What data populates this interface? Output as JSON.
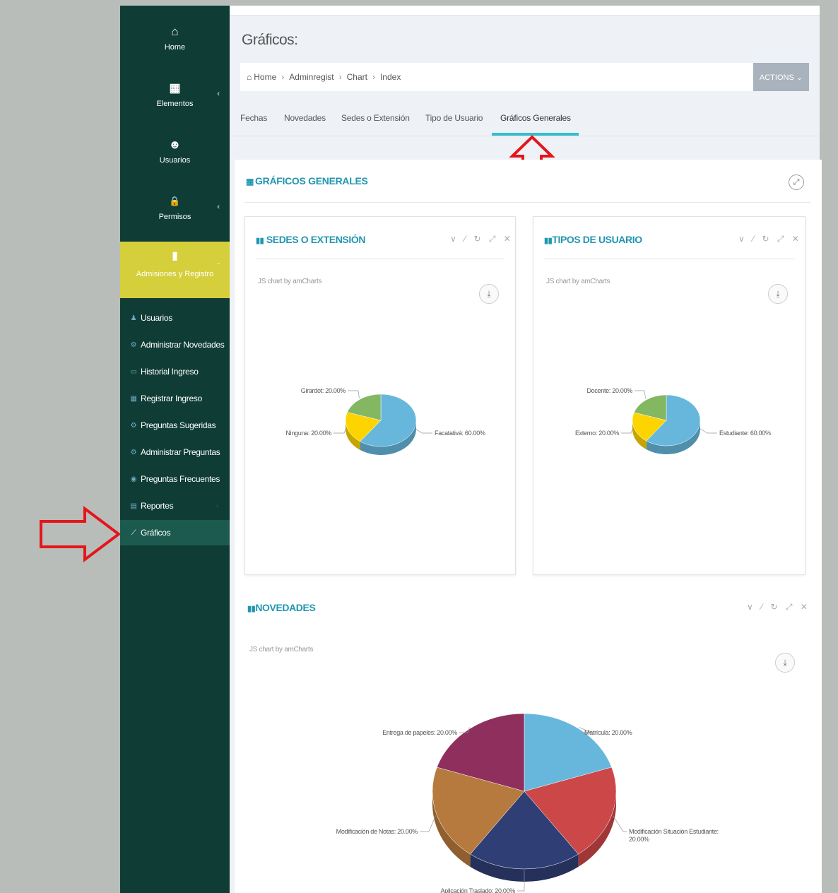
{
  "sidebar": {
    "top_items": [
      {
        "label": "Home",
        "icon": "home-icon",
        "glyph": "⌂"
      },
      {
        "label": "Elementos",
        "icon": "building-icon",
        "glyph": "▦",
        "chevron": "‹"
      },
      {
        "label": "Usuarios",
        "icon": "users-icon",
        "glyph": "☻"
      },
      {
        "label": "Permisos",
        "icon": "lock-icon",
        "glyph": "🔒",
        "chevron": "‹"
      }
    ],
    "admisiones": {
      "label": "Admisiones y Registro",
      "glyph": "▮",
      "chevron": "ˇ"
    },
    "sub_items": [
      {
        "label": "Usuarios",
        "icon": "user-icon",
        "glyph": "♟"
      },
      {
        "label": "Administrar Novedades",
        "icon": "cogs-icon",
        "glyph": "⚙"
      },
      {
        "label": "Historial Ingreso",
        "icon": "desktop-icon",
        "glyph": "▭"
      },
      {
        "label": "Registrar Ingreso",
        "icon": "table-icon",
        "glyph": "▦"
      },
      {
        "label": "Preguntas Sugeridas",
        "icon": "cogs-icon",
        "glyph": "⚙"
      },
      {
        "label": "Administrar Preguntas",
        "icon": "cogs-icon",
        "glyph": "⚙"
      },
      {
        "label": "Preguntas Frecuentes",
        "icon": "globe-icon",
        "glyph": "◉"
      },
      {
        "label": "Reportes",
        "icon": "file-icon",
        "glyph": "▤",
        "chevron": "‹"
      },
      {
        "label": "Gráficos",
        "icon": "line-chart-icon",
        "glyph": "⟋",
        "active": true
      }
    ]
  },
  "page_title": "Gráficos:",
  "breadcrumb": {
    "items": [
      "Home",
      "Adminregist",
      "Chart",
      "Index"
    ],
    "separator": "›",
    "home_glyph": "⌂"
  },
  "actions_label": "ACTIONS ⌄",
  "tabs": [
    {
      "label": "Fechas"
    },
    {
      "label": "Novedades"
    },
    {
      "label": "Sedes o Extensión"
    },
    {
      "label": "Tipo de Usuario"
    },
    {
      "label": "Gráficos Generales",
      "active": true
    }
  ],
  "portlet": {
    "title": "GRÁFICOS GENERALES",
    "title_icon": "▦",
    "fullscreen_glyph": "⤢"
  },
  "tools_glyphs": "∨ ⁄ ↻ ⤢ ✕",
  "credit": "JS chart by amCharts",
  "download_glyph": "⤓",
  "colors": {
    "sidebar_bg": "#0f3d35",
    "sidebar_active": "#1c5a4f",
    "admisiones_bg": "#d5cf3b",
    "title_blue": "#2196b0",
    "tab_underline": "#37bcd0",
    "annotation_red": "#e3161c"
  },
  "chart_data": [
    {
      "type": "pie",
      "title": "SEDES O EXTENSIÓN",
      "slices": [
        {
          "label": "Facatativá",
          "value": 60,
          "text": "Facatativá: 60.00%",
          "color": "#67b7dc"
        },
        {
          "label": "Ninguna",
          "value": 20,
          "text": "Ninguna: 20.00%",
          "color": "#fdd400"
        },
        {
          "label": "Girardot",
          "value": 20,
          "text": "Girardot: 20.00%",
          "color": "#84b761"
        }
      ]
    },
    {
      "type": "pie",
      "title": "TIPOS DE USUARIO",
      "slices": [
        {
          "label": "Estudiante",
          "value": 60,
          "text": "Estudiante: 60.00%",
          "color": "#67b7dc"
        },
        {
          "label": "Externo",
          "value": 20,
          "text": "Externo: 20.00%",
          "color": "#fdd400"
        },
        {
          "label": "Docente",
          "value": 20,
          "text": "Docente: 20.00%",
          "color": "#84b761"
        }
      ]
    },
    {
      "type": "pie",
      "title": "NOVEDADES",
      "slices": [
        {
          "label": "Matrícula",
          "value": 20,
          "text": "Matrícula: 20.00%",
          "color": "#67b7dc"
        },
        {
          "label": "Modificación Situación Estudiante",
          "value": 20,
          "text": "Modificación Situación Estudiante: 20.00%",
          "color": "#cc4748"
        },
        {
          "label": "Aplicación Traslado",
          "value": 20,
          "text": "Aplicación Traslado: 20.00%",
          "color": "#2f3e75"
        },
        {
          "label": "Modificación de Notas",
          "value": 20,
          "text": "Modificación de Notas: 20.00%",
          "color": "#b77a3e"
        },
        {
          "label": "Entrega de papeles",
          "value": 20,
          "text": "Entrega de papeles: 20.00%",
          "color": "#8f2f5e"
        }
      ]
    }
  ]
}
